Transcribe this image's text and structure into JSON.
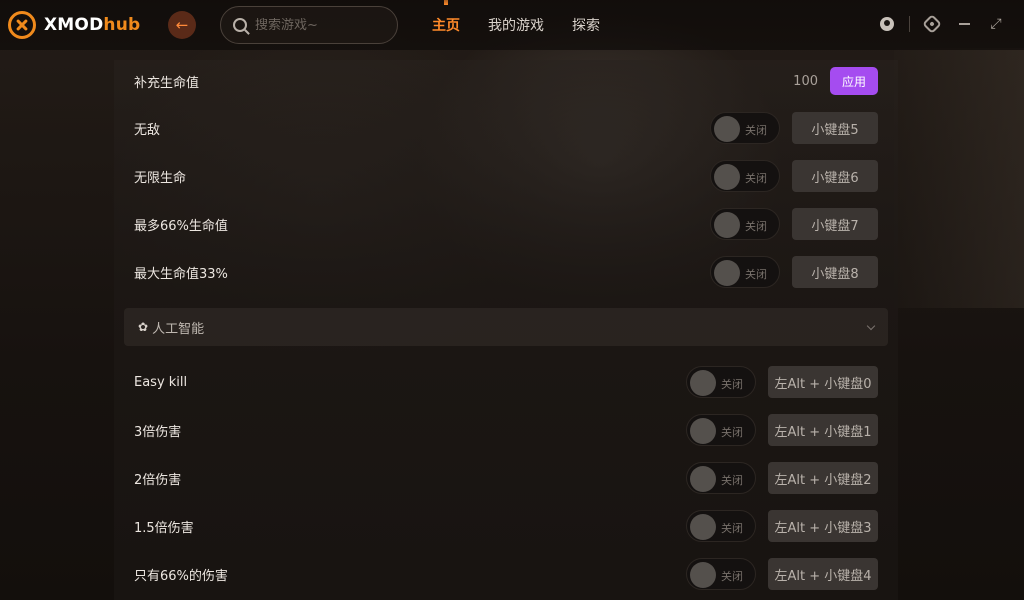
{
  "app": {
    "brand_part1": "XMOD",
    "brand_part2": "hub"
  },
  "search": {
    "placeholder": "搜索游戏~"
  },
  "nav": {
    "items": [
      {
        "label": "主页",
        "active": true
      },
      {
        "label": "我的游戏",
        "active": false
      },
      {
        "label": "探索",
        "active": false
      }
    ]
  },
  "health": {
    "rows": [
      {
        "label": "补充生命值",
        "value": "100",
        "apply": "应用"
      },
      {
        "label": "无敌",
        "toggle": "关闭",
        "hotkey": "小键盘5"
      },
      {
        "label": "无限生命",
        "toggle": "关闭",
        "hotkey": "小键盘6"
      },
      {
        "label": "最多66%生命值",
        "toggle": "关闭",
        "hotkey": "小键盘7"
      },
      {
        "label": "最大生命值33%",
        "toggle": "关闭",
        "hotkey": "小键盘8"
      }
    ]
  },
  "ai_section": {
    "title": "人工智能",
    "icon": "ai-icon",
    "rows": [
      {
        "label": "Easy kill",
        "toggle": "关闭",
        "hotkey": "左Alt + 小键盘0"
      },
      {
        "label": "3倍伤害",
        "toggle": "关闭",
        "hotkey": "左Alt + 小键盘1"
      },
      {
        "label": "2倍伤害",
        "toggle": "关闭",
        "hotkey": "左Alt + 小键盘2"
      },
      {
        "label": "1.5倍伤害",
        "toggle": "关闭",
        "hotkey": "左Alt + 小键盘3"
      },
      {
        "label": "只有66%的伤害",
        "toggle": "关闭",
        "hotkey": "左Alt + 小键盘4"
      }
    ]
  },
  "colors": {
    "accent": "#f08a1c",
    "apply_button": "#a54cf0",
    "background": "#1a1512"
  }
}
